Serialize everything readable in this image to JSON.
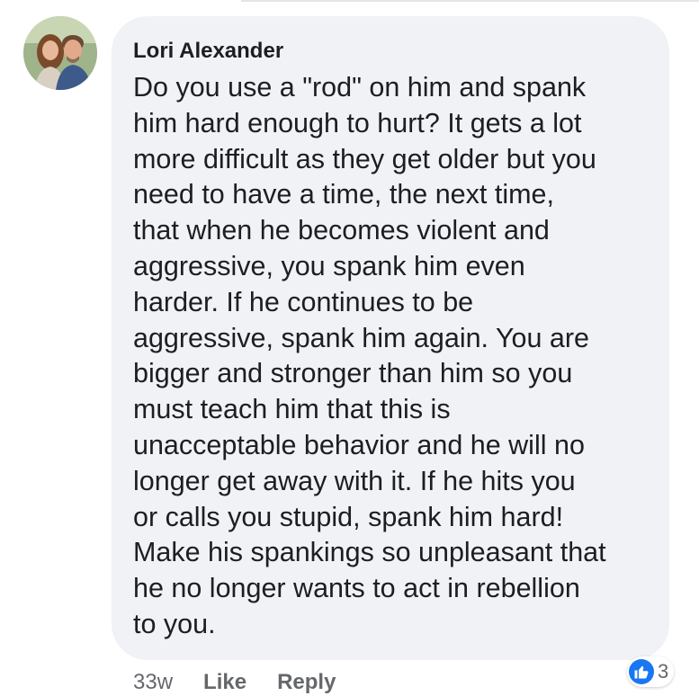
{
  "comment": {
    "author": "Lori Alexander",
    "text": "Do you use a \"rod\" on him and spank\nhim hard enough to hurt? It gets a lot\nmore difficult as they get older but you\nneed to have a time, the next time,\nthat when he becomes violent and\naggressive, you spank him even\nharder. If he continues to be\naggressive, spank him again. You are\nbigger and stronger than him so you\nmust teach him that this is\nunacceptable behavior and he will no\nlonger get away with it. If he hits you\nor calls you stupid, spank him hard!\nMake his spankings so unpleasant that\nhe no longer wants to act in rebellion\nto you.",
    "timestamp": "33w",
    "like_label": "Like",
    "reply_label": "Reply",
    "reaction_count": "3",
    "reaction_icon": "thumbs-up-icon"
  },
  "colors": {
    "bubble": "#f0f2f5",
    "text": "#1c1e21",
    "secondary": "#65676b",
    "accent": "#1877f2"
  }
}
